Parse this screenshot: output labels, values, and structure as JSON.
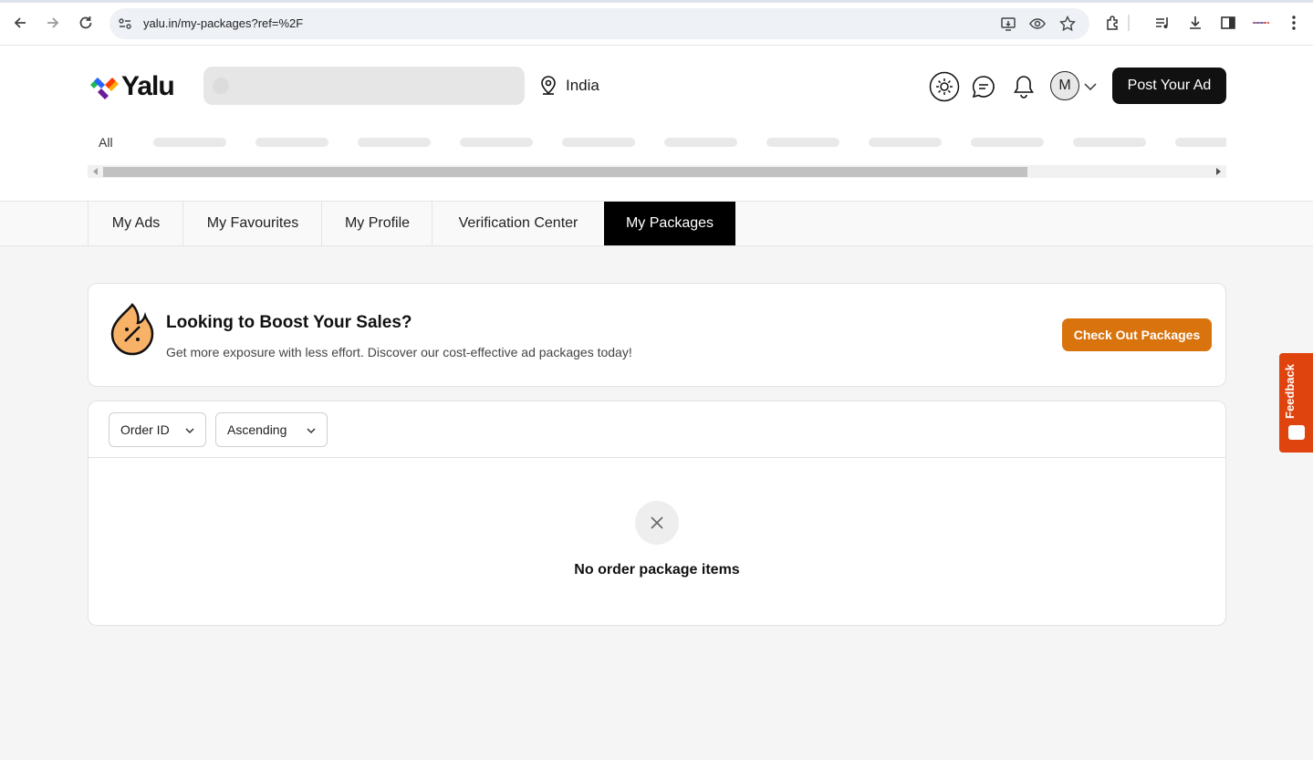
{
  "browser": {
    "url": "yalu.in/my-packages?ref=%2F"
  },
  "header": {
    "logo_text": "Yalu",
    "location": "India",
    "avatar_initial": "M",
    "post_ad_label": "Post Your Ad",
    "category_all": "All"
  },
  "tabs": [
    {
      "label": "My Ads",
      "active": false
    },
    {
      "label": "My Favourites",
      "active": false
    },
    {
      "label": "My Profile",
      "active": false
    },
    {
      "label": "Verification Center",
      "active": false
    },
    {
      "label": "My Packages",
      "active": true
    }
  ],
  "promo": {
    "title": "Looking to Boost Your Sales?",
    "subtitle": "Get more exposure with less effort. Discover our cost-effective ad packages today!",
    "button_label": "Check Out Packages"
  },
  "orders": {
    "sort_field": "Order ID",
    "sort_order": "Ascending",
    "empty_message": "No order package items"
  },
  "feedback": {
    "label": "Feedback"
  },
  "colors": {
    "accent_orange": "#d9730d",
    "feedback_red": "#e0440e",
    "active_tab": "#000000"
  }
}
